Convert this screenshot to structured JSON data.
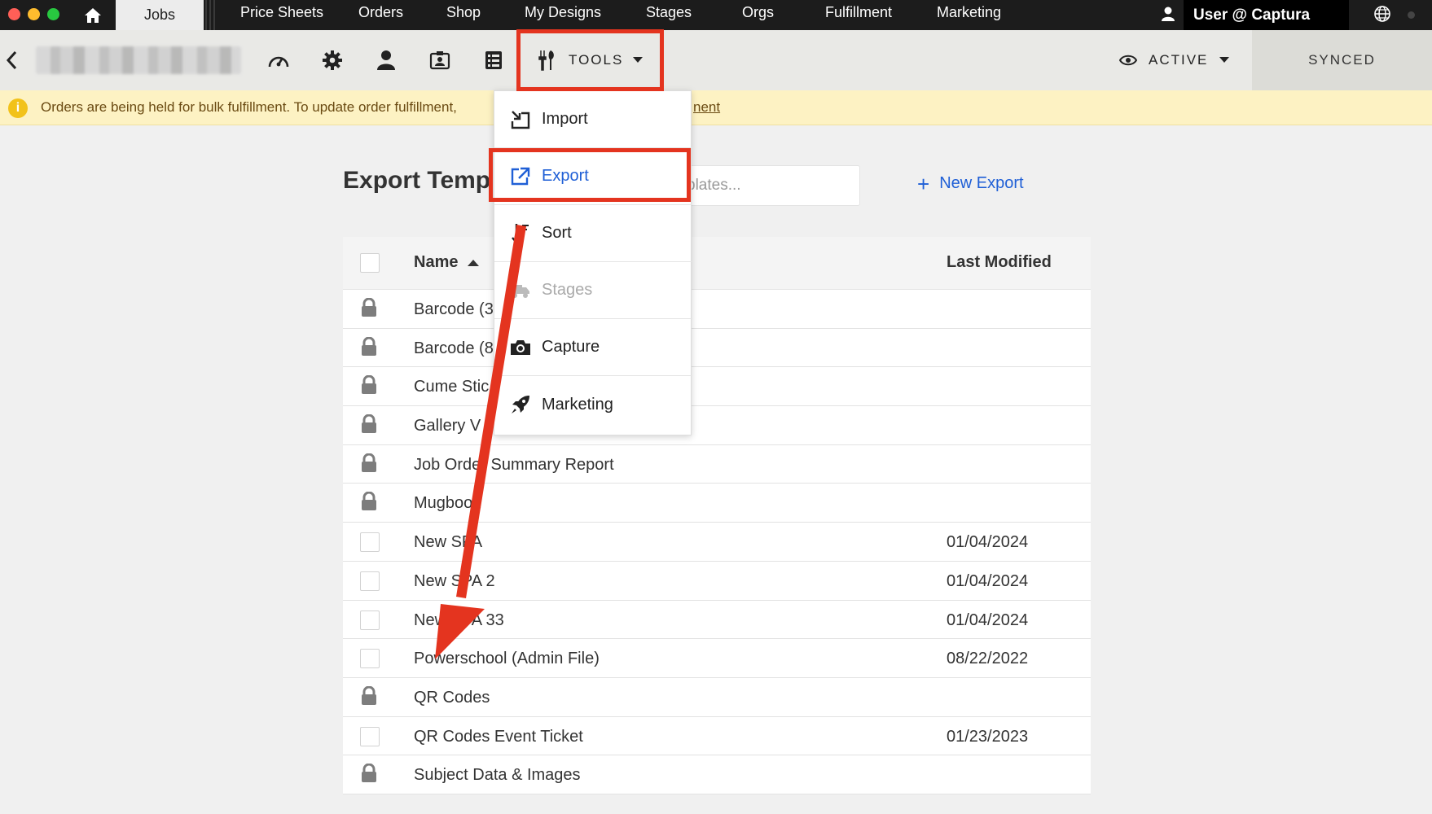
{
  "topnav": {
    "tabs": [
      "Jobs",
      "Price Sheets",
      "Orders",
      "Shop",
      "My Designs",
      "Stages",
      "Orgs",
      "Fulfillment",
      "Marketing"
    ],
    "user_label": "User @ Captura"
  },
  "toolbar": {
    "tools_label": "TOOLS",
    "active_label": "ACTIVE",
    "synced_label": "SYNCED"
  },
  "alert": {
    "text": "Orders are being held for bulk fulfillment. To update order fulfillment,",
    "link_fragment": "nent"
  },
  "tools_menu": {
    "items": [
      {
        "label": "Import",
        "icon": "import-icon",
        "state": "normal"
      },
      {
        "label": "Export",
        "icon": "export-icon",
        "state": "highlighted"
      },
      {
        "label": "Sort",
        "icon": "sort-icon",
        "state": "normal"
      },
      {
        "label": "Stages",
        "icon": "truck-icon",
        "state": "disabled"
      },
      {
        "label": "Capture",
        "icon": "camera-icon",
        "state": "normal"
      },
      {
        "label": "Marketing",
        "icon": "rocket-icon",
        "state": "normal"
      }
    ]
  },
  "content": {
    "title": "Export Temp",
    "search_placeholder": "plates...",
    "new_export_label": "New Export",
    "table": {
      "headers": {
        "name": "Name",
        "last_modified": "Last Modified"
      },
      "rows": [
        {
          "name": "Barcode (3",
          "date": "",
          "locked": true
        },
        {
          "name": "Barcode (8",
          "date": "",
          "locked": true
        },
        {
          "name": "Cume Stic",
          "date": "",
          "locked": true
        },
        {
          "name": "Gallery V",
          "date": "",
          "locked": true
        },
        {
          "name": "Job Order Summary Report",
          "date": "",
          "locked": true
        },
        {
          "name": "Mugbook",
          "date": "",
          "locked": true
        },
        {
          "name": "New SPA",
          "date": "01/04/2024",
          "locked": false
        },
        {
          "name": "New SPA 2",
          "date": "01/04/2024",
          "locked": false
        },
        {
          "name": "New SPA 33",
          "date": "01/04/2024",
          "locked": false
        },
        {
          "name": "Powerschool (Admin File)",
          "date": "08/22/2022",
          "locked": false
        },
        {
          "name": "QR Codes",
          "date": "",
          "locked": true
        },
        {
          "name": "QR Codes Event Ticket",
          "date": "01/23/2023",
          "locked": false
        },
        {
          "name": "Subject Data & Images",
          "date": "",
          "locked": true
        }
      ]
    }
  },
  "colors": {
    "annotation_red": "#e4341f",
    "link_blue": "#1f5fd6",
    "alert_bg": "#fdf2c3"
  }
}
